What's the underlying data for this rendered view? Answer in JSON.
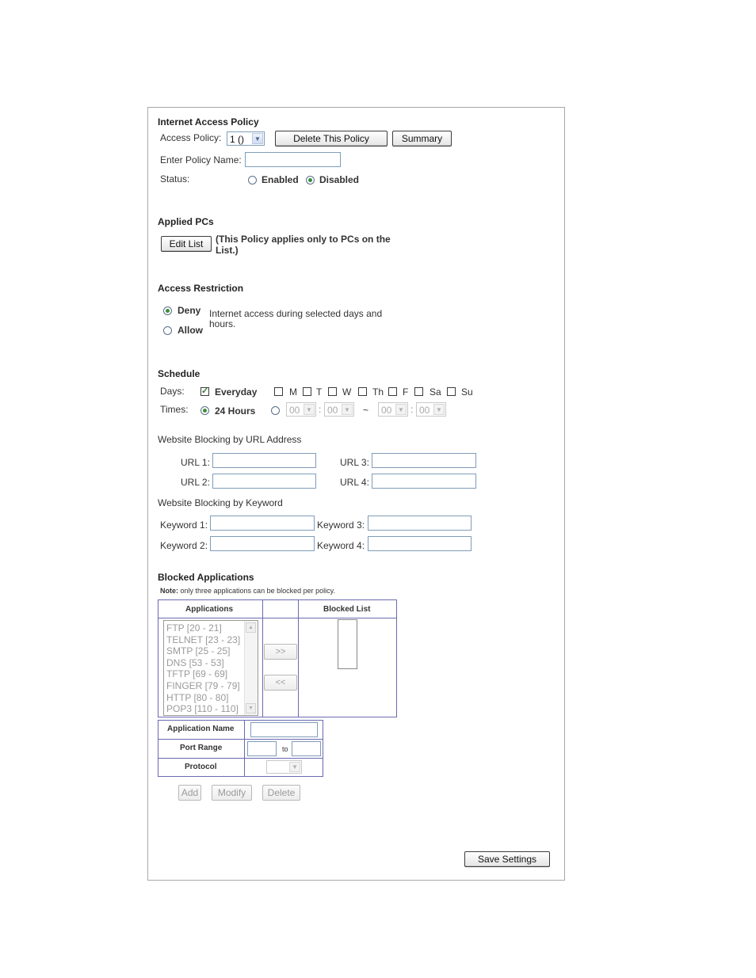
{
  "policy": {
    "section_title": "Internet Access Policy",
    "access_policy_label": "Access Policy:",
    "access_policy_value": "1 ()",
    "delete_button": "Delete This Policy",
    "summary_button": "Summary",
    "policy_name_label": "Enter Policy Name:",
    "policy_name_value": "",
    "status_label": "Status:",
    "enabled_label": "Enabled",
    "disabled_label": "Disabled",
    "status_selected": "Disabled"
  },
  "applied_pcs": {
    "section_title": "Applied PCs",
    "edit_list_button": "Edit List",
    "note_line1": "(This Policy applies only to PCs on the",
    "note_line2": "List.)"
  },
  "restriction": {
    "section_title": "Access Restriction",
    "deny_label": "Deny",
    "allow_label": "Allow",
    "selected": "Deny",
    "desc_line1": "Internet access during selected days and",
    "desc_line2": "hours."
  },
  "schedule": {
    "section_title": "Schedule",
    "days_label": "Days:",
    "everyday_label": "Everyday",
    "everyday_checked": true,
    "days": [
      "M",
      "T",
      "W",
      "Th",
      "F",
      "Sa",
      "Su"
    ],
    "times_label": "Times:",
    "hours24_label": "24 Hours",
    "time_start_hour": "00",
    "time_start_min": "00",
    "time_end_hour": "00",
    "time_end_min": "00",
    "colon": ":",
    "tilde": "~"
  },
  "url_blocking": {
    "section_title": "Website Blocking by URL Address",
    "url1_label": "URL 1:",
    "url2_label": "URL 2:",
    "url3_label": "URL 3:",
    "url4_label": "URL 4:"
  },
  "keyword_blocking": {
    "section_title": "Website Blocking by Keyword",
    "kw1_label": "Keyword 1:",
    "kw2_label": "Keyword 2:",
    "kw3_label": "Keyword 3:",
    "kw4_label": "Keyword 4:"
  },
  "blocked_apps": {
    "section_title": "Blocked Applications",
    "note_bold": "Note:",
    "note_text": " only three applications can be blocked per policy.",
    "applications_header": "Applications",
    "blocked_list_header": "Blocked List",
    "applications": [
      "FTP [20 - 21]",
      "TELNET [23 - 23]",
      "SMTP [25 - 25]",
      "DNS [53 - 53]",
      "TFTP [69 - 69]",
      "FINGER [79 - 79]",
      "HTTP [80 - 80]",
      "POP3 [110 - 110]"
    ],
    "add_arrow": ">>",
    "remove_arrow": "<<",
    "app_name_label": "Application Name",
    "port_range_label": "Port Range",
    "to_label": "to",
    "protocol_label": "Protocol",
    "add_button": "Add",
    "modify_button": "Modify",
    "delete_button": "Delete"
  },
  "footer": {
    "save_button": "Save Settings"
  },
  "colors": {
    "frame_border": "#a8a8a8",
    "table_border": "#6a6ab0",
    "input_border": "#7f9db9",
    "radio_dot": "#3a8f3a",
    "check_mark": "#2e7d2e"
  }
}
